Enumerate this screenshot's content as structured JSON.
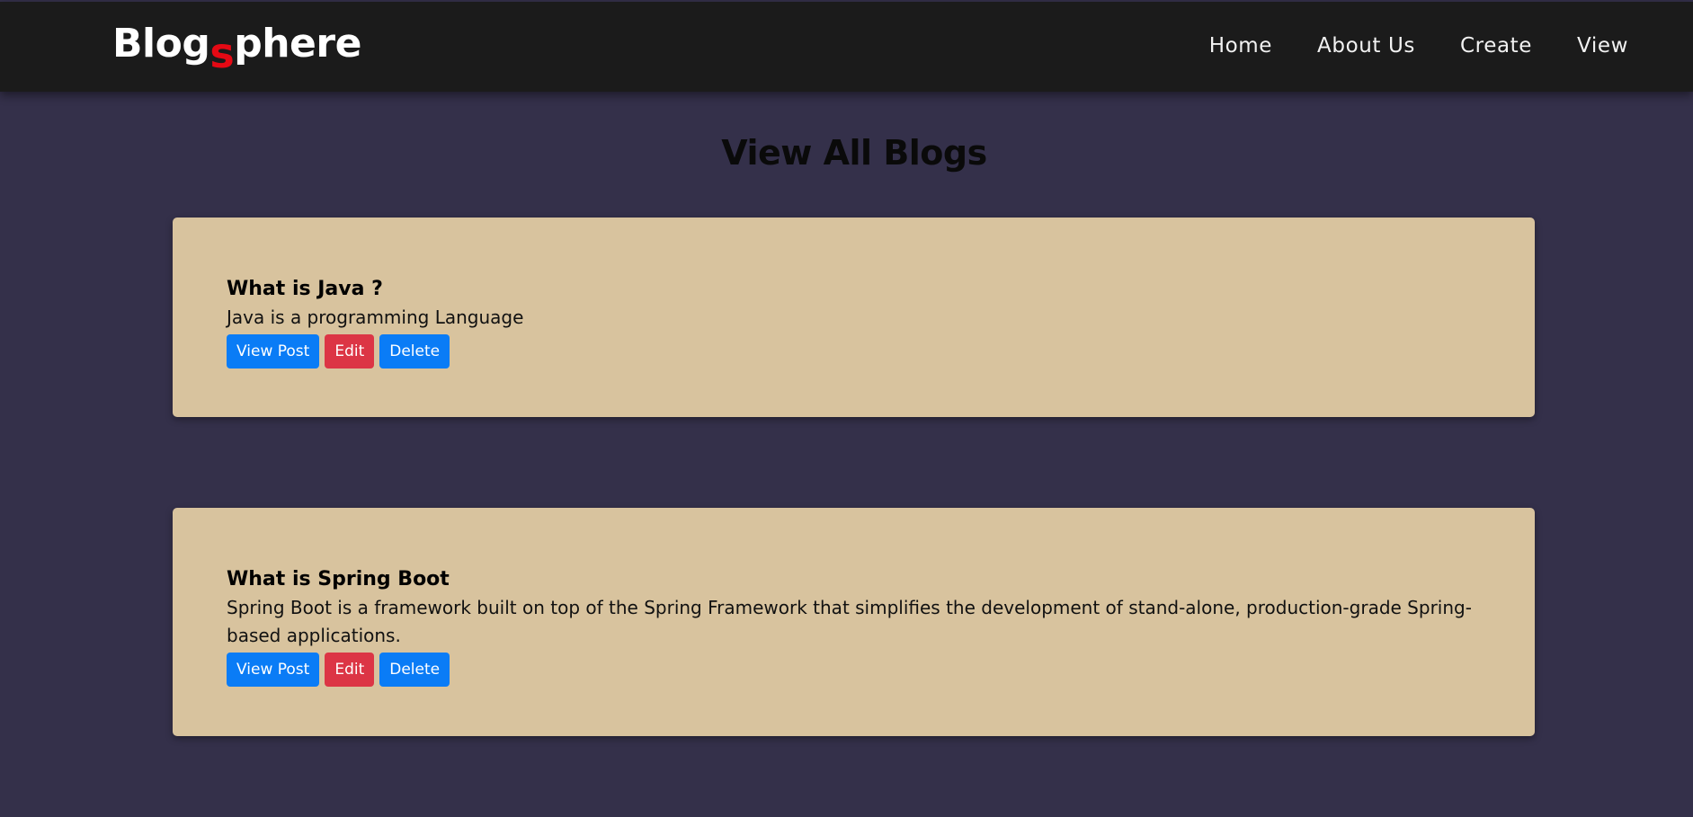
{
  "header": {
    "logo_prefix": "Blog",
    "logo_accent": "s",
    "logo_suffix": "phere",
    "nav": [
      {
        "label": "Home"
      },
      {
        "label": "About Us"
      },
      {
        "label": "Create"
      },
      {
        "label": "View"
      }
    ]
  },
  "page": {
    "title": "View All Blogs"
  },
  "posts": [
    {
      "title": "What is Java ?",
      "body": "Java is a programming Language",
      "view_label": "View Post",
      "edit_label": "Edit",
      "delete_label": "Delete"
    },
    {
      "title": "What is Spring Boot",
      "body": "Spring Boot is a framework built on top of the Spring Framework that simplifies the development of stand-alone, production-grade Spring-based applications.",
      "view_label": "View Post",
      "edit_label": "Edit",
      "delete_label": "Delete"
    }
  ],
  "colors": {
    "background": "#34304a",
    "navbar": "#1b1b1b",
    "card": "#d8c39e",
    "logo_accent": "#e50914",
    "button_primary": "#0a7cf6",
    "button_danger": "#dc3545"
  }
}
